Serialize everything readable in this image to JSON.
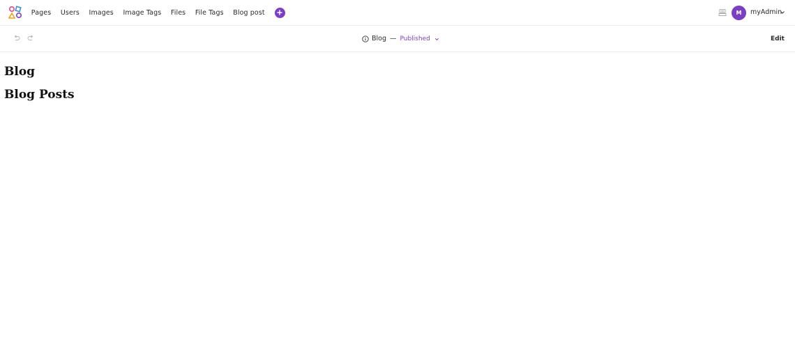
{
  "nav": {
    "items": [
      {
        "label": "Pages"
      },
      {
        "label": "Users"
      },
      {
        "label": "Images"
      },
      {
        "label": "Image Tags"
      },
      {
        "label": "Files"
      },
      {
        "label": "File Tags"
      },
      {
        "label": "Blog post"
      }
    ],
    "add_icon": "plus-icon"
  },
  "user": {
    "avatar_initial": "M",
    "name": "myAdmin",
    "avatar_color": "#7b3fc4"
  },
  "toolbar": {
    "undo_icon": "undo-icon",
    "redo_icon": "redo-icon",
    "doc_title": "Blog",
    "separator": "—",
    "status": "Published",
    "edit_label": "Edit"
  },
  "content": {
    "heading": "Blog",
    "subheading": "Blog Posts"
  },
  "colors": {
    "accent": "#7b3fc4"
  }
}
